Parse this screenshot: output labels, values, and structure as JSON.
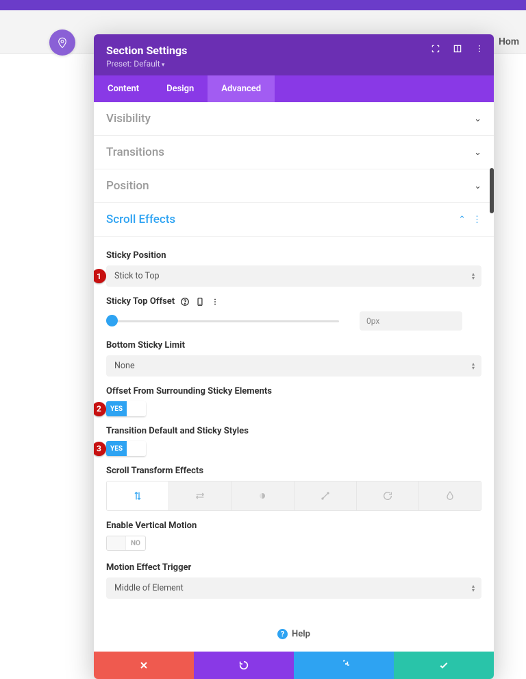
{
  "site": {
    "nav_home": "Hom"
  },
  "header": {
    "title": "Section Settings",
    "preset": "Preset: Default"
  },
  "tabs": {
    "content": "Content",
    "design": "Design",
    "advanced": "Advanced"
  },
  "accordions": {
    "visibility": "Visibility",
    "transitions": "Transitions",
    "position": "Position",
    "scroll_effects": "Scroll Effects"
  },
  "scroll": {
    "sticky_position_label": "Sticky Position",
    "sticky_position_value": "Stick to Top",
    "sticky_top_offset_label": "Sticky Top Offset",
    "sticky_top_offset_value": "0px",
    "bottom_sticky_limit_label": "Bottom Sticky Limit",
    "bottom_sticky_limit_value": "None",
    "offset_surrounding_label": "Offset From Surrounding Sticky Elements",
    "offset_surrounding_value": "YES",
    "transition_styles_label": "Transition Default and Sticky Styles",
    "transition_styles_value": "YES",
    "scroll_transform_label": "Scroll Transform Effects",
    "enable_vertical_label": "Enable Vertical Motion",
    "enable_vertical_value": "NO",
    "motion_trigger_label": "Motion Effect Trigger",
    "motion_trigger_value": "Middle of Element"
  },
  "badges": {
    "one": "1",
    "two": "2",
    "three": "3"
  },
  "help": "Help"
}
